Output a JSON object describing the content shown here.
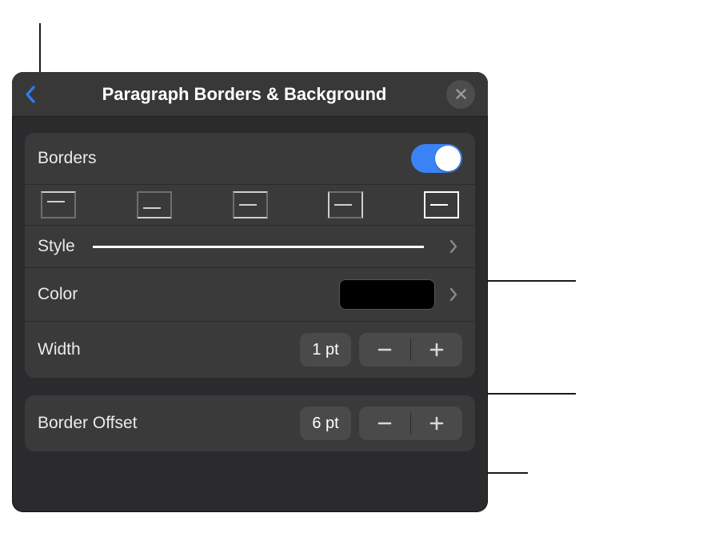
{
  "header": {
    "title": "Paragraph Borders & Background"
  },
  "borders": {
    "label": "Borders",
    "enabled": true
  },
  "style": {
    "label": "Style"
  },
  "color": {
    "label": "Color",
    "value": "#000000"
  },
  "width": {
    "label": "Width",
    "value": "1 pt"
  },
  "offset": {
    "label": "Border Offset",
    "value": "6 pt"
  }
}
